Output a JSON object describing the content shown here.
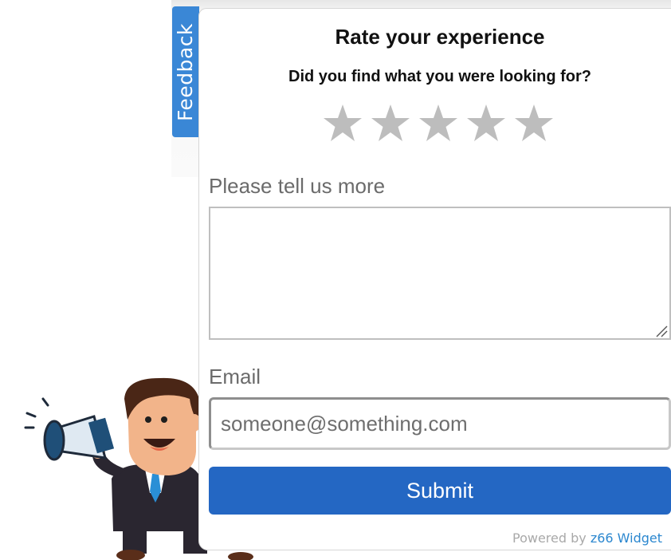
{
  "tab": {
    "label": "Feedback"
  },
  "form": {
    "title": "Rate your experience",
    "question": "Did you find what you were looking for?",
    "rating": {
      "max": 5,
      "value": 0,
      "star_color": "#bdbdbd"
    },
    "more_label": "Please tell us more",
    "comment": {
      "value": "",
      "placeholder": ""
    },
    "email_label": "Email",
    "email": {
      "value": "",
      "placeholder": "someone@something.com"
    },
    "submit_label": "Submit"
  },
  "footer": {
    "powered_prefix": "Powered by",
    "brand": "z66 Widget"
  },
  "colors": {
    "accent": "#2467c3",
    "tab": "#3a87d6",
    "brand_link": "#2b87cf"
  },
  "mascot": {
    "icon": "businessman-megaphone-icon"
  }
}
